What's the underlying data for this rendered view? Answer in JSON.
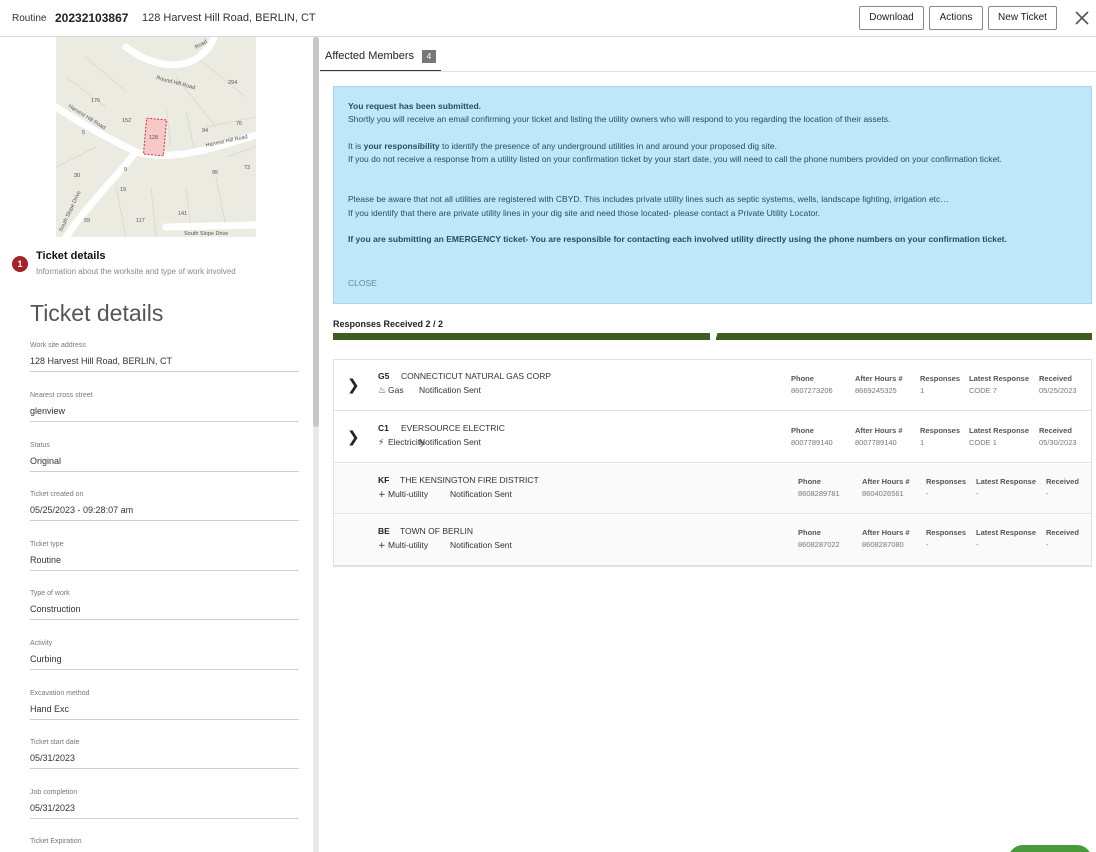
{
  "header": {
    "ticket_type": "Routine",
    "ticket_number": "20232103867",
    "address": "128 Harvest Hill Road, BERLIN, CT",
    "download_label": "Download",
    "actions_label": "Actions",
    "new_ticket_label": "New Ticket",
    "close_icon": "close-icon"
  },
  "map": {
    "road_labels": [
      "Round Hill Road",
      "Harvest Hill Road",
      "Harvest Hill Road",
      "South Slope Drive",
      "South Slope Drive",
      "Road"
    ],
    "lot_numbers": [
      "294",
      "176",
      "152",
      "128",
      "94",
      "76",
      "5",
      "73",
      "30",
      "95",
      "9",
      "19",
      "117",
      "141",
      "59"
    ]
  },
  "step": {
    "number": "1",
    "title": "Ticket details",
    "subtitle": "Information about the worksite and type of work involved"
  },
  "details": {
    "section_title": "Ticket details",
    "fields": [
      {
        "label": "Work site address",
        "value": "128 Harvest Hill Road, BERLIN, CT"
      },
      {
        "label": "Nearest cross street",
        "value": "glenview"
      },
      {
        "label": "Status",
        "value": "Original"
      },
      {
        "label": "Ticket created on",
        "value": "05/25/2023 - 09:28:07 am"
      },
      {
        "label": "Ticket type",
        "value": "Routine"
      },
      {
        "label": "Type of work",
        "value": "Construction"
      },
      {
        "label": "Activity",
        "value": "Curbing"
      },
      {
        "label": "Excavation method",
        "value": "Hand Exc"
      },
      {
        "label": "Ticket start date",
        "value": "05/31/2023"
      },
      {
        "label": "Job completion",
        "value": "05/31/2023"
      },
      {
        "label": "Ticket Expiration",
        "value": ""
      }
    ]
  },
  "tabs": {
    "affected_members_label": "Affected Members",
    "affected_members_count": "4"
  },
  "alert": {
    "heading": "You request has been submitted.",
    "line1": "Shortly you will receive an email confirming your ticket and listing the utility owners who will respond to you regarding the location of their assets.",
    "resp_prefix": "It is ",
    "resp_bold": "your responsibility",
    "resp_suffix": " to identify the presence of any underground utilities in and around your proposed dig site.",
    "line3": "If you do not receive a response from a utility listed on your confirmation ticket by your start date, you will need to call the phone numbers provided on your confirmation ticket.",
    "line4": "Please be aware that not all utilities are registered with CBYD. This includes private utility lines such as septic systems, wells, landscape lighting, irrigation etc…",
    "line5": "If you identify that there are private utility lines in your dig site and need those located- please contact a Private Utility Locator.",
    "emergency": "If you are submitting an EMERGENCY ticket- You are responsible for contacting each involved utility directly using the phone numbers on your confirmation ticket.",
    "close_label": "CLOSE"
  },
  "responses": {
    "label": "Responses Received 2 / 2",
    "received": 2,
    "total": 2,
    "bar_color": "#3e5d22"
  },
  "column_headers": {
    "phone": "Phone",
    "after_hours": "After Hours #",
    "responses": "Responses",
    "latest_response": "Latest Response",
    "received": "Received"
  },
  "members": [
    {
      "code": "G5",
      "name": "CONNECTICUT NATURAL GAS CORP",
      "category": "Gas",
      "category_icon": "flame-icon",
      "status": "Notification Sent",
      "phone": "8607273206",
      "after_hours": "8669245325",
      "responses": "1",
      "latest_response": "CODE 7",
      "received": "05/25/2023"
    },
    {
      "code": "C1",
      "name": "EVERSOURCE ELECTRIC",
      "category": "Electricity",
      "category_icon": "bolt-icon",
      "status": "Notification Sent",
      "phone": "8007789140",
      "after_hours": "8007789140",
      "responses": "1",
      "latest_response": "CODE 1",
      "received": "05/30/2023"
    },
    {
      "code": "KF",
      "name": "THE KENSINGTON FIRE DISTRICT",
      "category": "Multi-utility",
      "category_icon": "plus-icon",
      "status": "Notification Sent",
      "phone": "8608289781",
      "after_hours": "8604026561",
      "responses": "-",
      "latest_response": "-",
      "received": "-"
    },
    {
      "code": "BE",
      "name": "TOWN OF BERLIN",
      "category": "Multi-utility",
      "category_icon": "plus-icon",
      "status": "Notification Sent",
      "phone": "8608287022",
      "after_hours": "8608287080",
      "responses": "-",
      "latest_response": "-",
      "received": "-"
    }
  ]
}
